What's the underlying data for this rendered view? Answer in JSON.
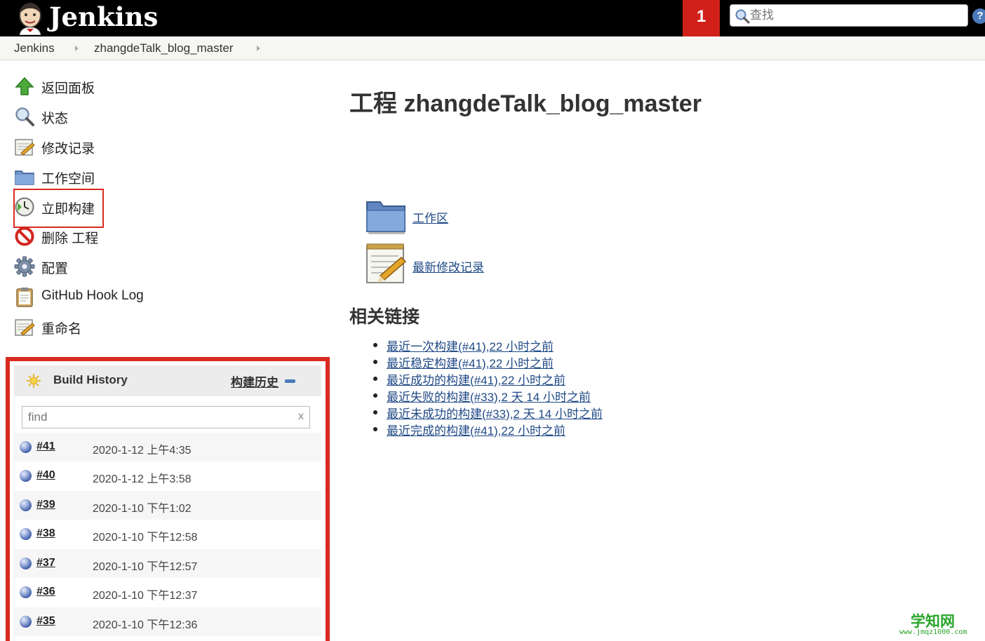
{
  "header": {
    "brand": "Jenkins",
    "notification_count": "1",
    "search_placeholder": "查找"
  },
  "breadcrumb": {
    "items": [
      "Jenkins",
      "zhangdeTalk_blog_master"
    ]
  },
  "sidebar": {
    "tasks": [
      {
        "label": "返回面板",
        "icon": "up-arrow-icon"
      },
      {
        "label": "状态",
        "icon": "magnifier-icon"
      },
      {
        "label": "修改记录",
        "icon": "notepad-icon"
      },
      {
        "label": "工作空间",
        "icon": "folder-icon"
      },
      {
        "label": "立即构建",
        "icon": "clock-icon"
      },
      {
        "label": "删除 工程",
        "icon": "no-entry-icon"
      },
      {
        "label": "配置",
        "icon": "gear-icon"
      },
      {
        "label": "GitHub Hook Log",
        "icon": "clipboard-icon"
      },
      {
        "label": "重命名",
        "icon": "notepad-icon"
      }
    ]
  },
  "build_history": {
    "title": "Build History",
    "trend_label": "构建历史",
    "find_placeholder": "find",
    "clear_label": "x",
    "builds": [
      {
        "number": "#41",
        "date": "2020-1-12 上午4:35"
      },
      {
        "number": "#40",
        "date": "2020-1-12 上午3:58"
      },
      {
        "number": "#39",
        "date": "2020-1-10 下午1:02"
      },
      {
        "number": "#38",
        "date": "2020-1-10 下午12:58"
      },
      {
        "number": "#37",
        "date": "2020-1-10 下午12:57"
      },
      {
        "number": "#36",
        "date": "2020-1-10 下午12:37"
      },
      {
        "number": "#35",
        "date": "2020-1-10 下午12:36"
      }
    ]
  },
  "main": {
    "title": "工程 zhangdeTalk_blog_master",
    "links": [
      {
        "label": "工作区",
        "icon": "folder-icon"
      },
      {
        "label": "最新修改记录",
        "icon": "notepad-icon"
      }
    ],
    "related_heading": "相关链接",
    "permalinks": [
      "最近一次构建(#41),22 小时之前",
      "最近稳定构建(#41),22 小时之前",
      "最近成功的构建(#41),22 小时之前",
      "最近失败的构建(#33),2 天 14 小时之前",
      "最近未成功的构建(#33),2 天 14 小时之前",
      "最近完成的构建(#41),22 小时之前"
    ]
  },
  "watermark": {
    "line1": "学知网",
    "line2": "www.jmqz1000.com"
  },
  "colors": {
    "header_bg": "#000000",
    "notification_bg": "#d1201a",
    "highlight_border": "#d92a20",
    "link": "#204a87"
  }
}
